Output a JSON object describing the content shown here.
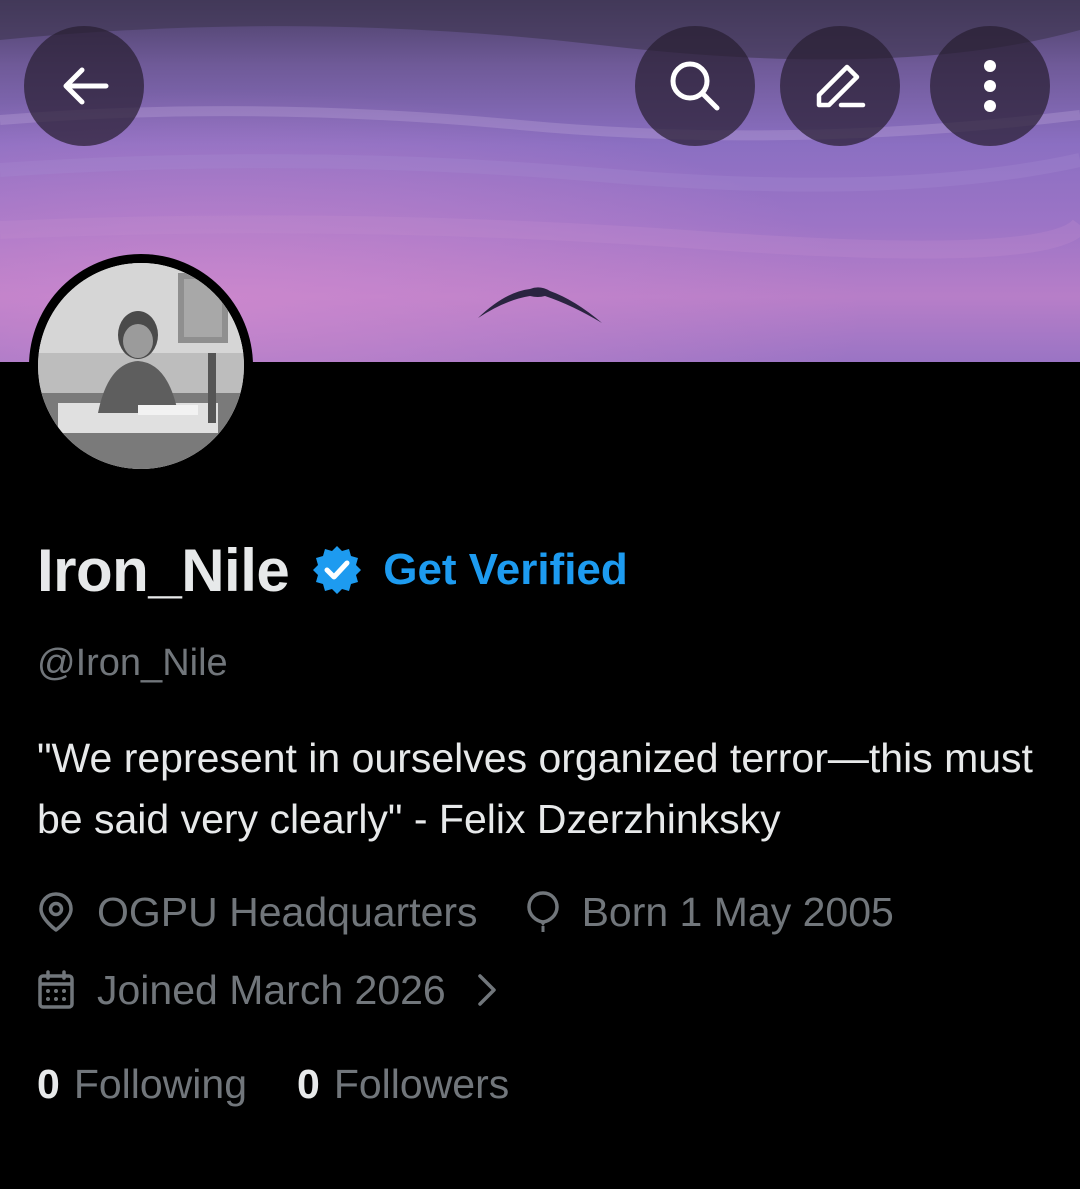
{
  "profile": {
    "display_name": "Iron_Nile",
    "get_verified_label": "Get Verified",
    "handle": "@Iron_Nile",
    "bio": "\"We represent in ourselves organized terror—this must be said very clearly\" - Felix Dzerzhinksky",
    "location": "OGPU Headquarters",
    "birthday": "Born 1 May 2005",
    "joined": "Joined March 2026",
    "following_count": "0",
    "following_label": "Following",
    "followers_count": "0",
    "followers_label": "Followers"
  },
  "toolbar": {
    "back_icon": "arrow-left-icon",
    "search_icon": "search-icon",
    "edit_icon": "pencil-icon",
    "more_icon": "more-vertical-icon"
  },
  "icons": {
    "verified": "verified-badge-icon",
    "location": "location-pin-icon",
    "birthday": "balloon-icon",
    "joined": "calendar-icon",
    "chevron": "chevron-right-icon"
  },
  "colors": {
    "background": "#000000",
    "text_primary": "#e7e9ea",
    "text_secondary": "#71767b",
    "accent": "#1d9bf0"
  }
}
